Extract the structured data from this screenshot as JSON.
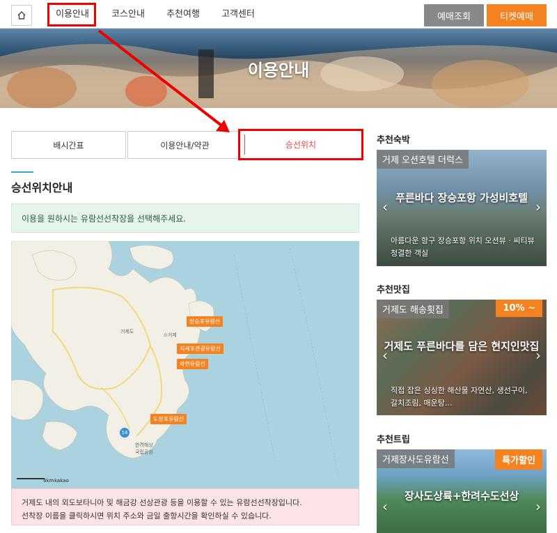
{
  "nav": {
    "items": [
      "이용안내",
      "코스안내",
      "추천여행",
      "고객센터"
    ],
    "reserve_label": "예매조회",
    "ticket_label": "티켓예매"
  },
  "hero": {
    "title": "이용안내"
  },
  "tabs": [
    "배시간표",
    "이용안내/약관",
    "승선위치"
  ],
  "section": {
    "title": "승선위치안내",
    "notice": "이용을 원하시는 유람선선착장을 선택해주세요."
  },
  "map": {
    "pins": [
      "장승포유람선",
      "지세포관광유람선",
      "와현유람선",
      "도장포유람선"
    ],
    "labels": [
      "거제도",
      "⊙거제",
      "한려해상\n국립공원"
    ],
    "road_num": "14",
    "scale": "4km",
    "brand": "kakao"
  },
  "info": {
    "line1": "거제도 내의 외도보타니아 및 해금강 선상관광 등을 이용할 수 있는 유람선선착장입니다.",
    "line2": "선착장 이름을 클릭하시면 위치 주소와 금일 출항시간을 확인하실 수 있습니다."
  },
  "sidebar": {
    "stay": {
      "heading": "추천숙박",
      "tag": "거제 오션호텔 더럭스",
      "headline": "푸른바다 장승포항 가성비호텔",
      "desc": "아름다운 항구 장승포항 위치 오션뷰 · 씨티뷰 청결한 객실"
    },
    "food": {
      "heading": "추천맛집",
      "tag": "거제도 해송횟집",
      "badge": "10% ~",
      "headline": "거제도 푸른바다를 담은 현지인맛집",
      "desc": "직접 잡은 싱싱한 해산물 자연산, 생선구이, 갈치조림, 매운탕..."
    },
    "trip": {
      "heading": "추천트립",
      "tag": "거제장사도유람선",
      "badge": "특가할인",
      "headline": "장사도상륙+한려수도선상"
    }
  },
  "colors": {
    "accent": "#f58220",
    "highlight": "#e00000",
    "gray_button": "#888888"
  }
}
